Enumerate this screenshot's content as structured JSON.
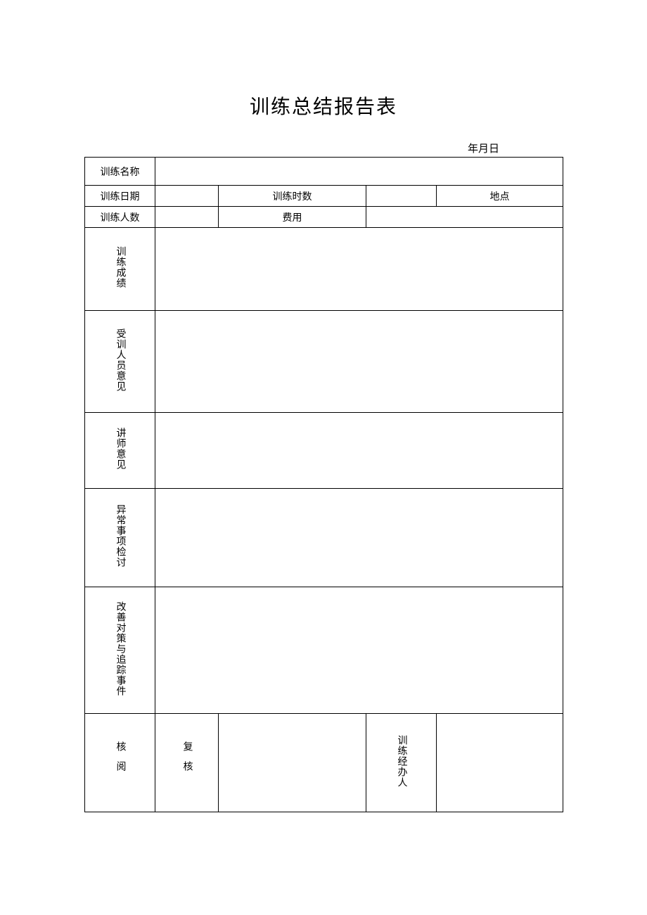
{
  "title": "训练总结报告表",
  "date_label": "年月日",
  "labels": {
    "training_name": "训练名称",
    "training_date": "训练日期",
    "training_hours": "训练时数",
    "location": "地点",
    "training_count": "训练人数",
    "cost": "费用",
    "results": "训练成绩",
    "trainee_opinion": "受训人员意见",
    "instructor_opinion": "讲师意见",
    "abnormal_review": "异常事项检讨",
    "improvement": "改善对策与追踪事件",
    "review": "核阅",
    "recheck": "复核",
    "organizer": "训练经办人"
  },
  "values": {
    "training_name": "",
    "training_date": "",
    "training_hours": "",
    "location": "",
    "training_count": "",
    "cost": "",
    "results": "",
    "trainee_opinion": "",
    "instructor_opinion": "",
    "abnormal_review": "",
    "improvement": "",
    "review_sig": "",
    "recheck_sig": "",
    "organizer_sig": ""
  }
}
